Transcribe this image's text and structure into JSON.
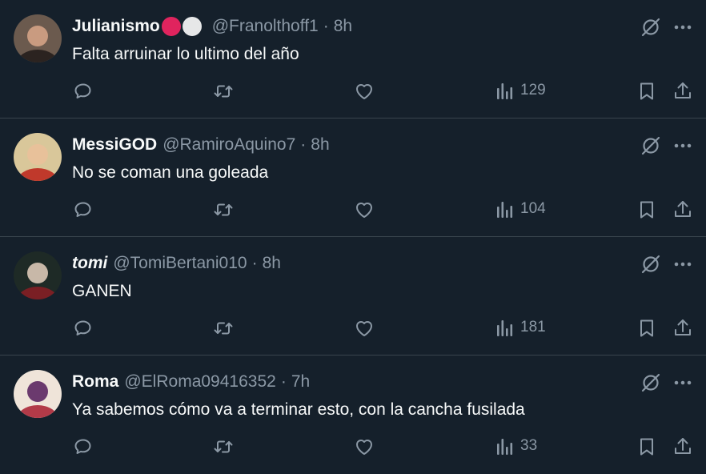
{
  "tweets": [
    {
      "name": "Julianismo",
      "name_italic": false,
      "emoji": [
        "#e0245e",
        "#e6e7e8"
      ],
      "handle": "@Franolthoff1",
      "time": "8h",
      "text": "Falta arruinar lo ultimo del año",
      "views": "129",
      "avatar_colors": [
        "#6b5a4e",
        "#2b2320",
        "#c99b80"
      ]
    },
    {
      "name": "MessiGOD",
      "name_italic": false,
      "emoji": [],
      "handle": "@RamiroAquino7",
      "time": "8h",
      "text": "No se coman una goleada",
      "views": "104",
      "avatar_colors": [
        "#d9c79a",
        "#c0392b",
        "#e8c19a"
      ]
    },
    {
      "name": "tomi",
      "name_italic": true,
      "emoji": [],
      "handle": "@TomiBertani010",
      "time": "8h",
      "text": "GANEN",
      "views": "181",
      "avatar_colors": [
        "#1e2a26",
        "#7a1f24",
        "#c8b8a8"
      ]
    },
    {
      "name": "Roma",
      "name_italic": false,
      "emoji": [],
      "handle": "@ElRoma09416352",
      "time": "7h",
      "text": "Ya sabemos cómo va a terminar esto, con la cancha fusilada",
      "views": "33",
      "avatar_colors": [
        "#efe4d9",
        "#b23a48",
        "#6b3a6e"
      ]
    }
  ],
  "icons": {
    "reply": "reply-icon",
    "retweet": "retweet-icon",
    "like": "heart-icon",
    "views": "views-chart-icon",
    "bookmark": "bookmark-icon",
    "share": "share-icon",
    "grok": "grok-icon",
    "more": "more-icon"
  },
  "colors": {
    "background": "#15202b",
    "secondary_text": "#8b98a5",
    "divider": "#38444d"
  }
}
